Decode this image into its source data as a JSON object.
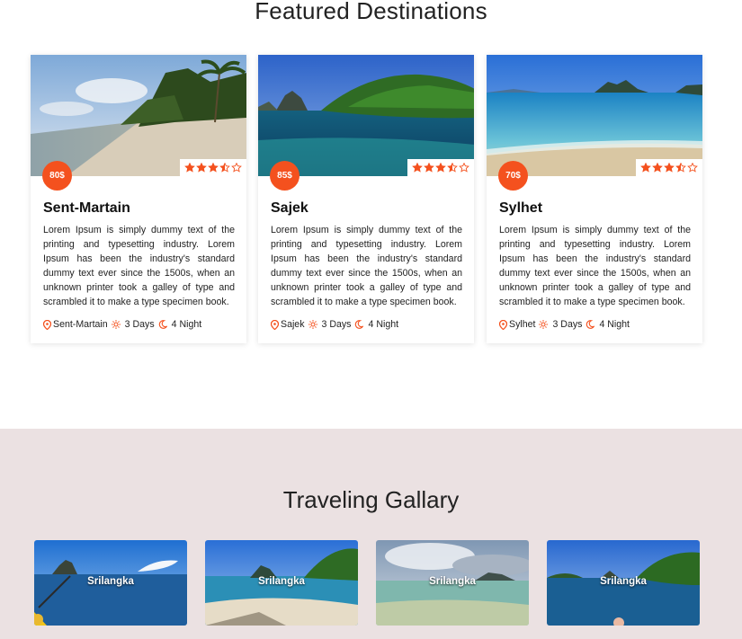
{
  "featured": {
    "title": "Featured Destinations",
    "cards": [
      {
        "price": "80$",
        "title": "Sent-Martain",
        "text": "Lorem Ipsum is simply dummy text of the printing and typesetting industry. Lorem Ipsum has been the industry's standard dummy text ever since the 1500s, when an unknown printer took a galley of type and scrambled it to make a type specimen book.",
        "location": "Sent-Martain",
        "days": "3 Days",
        "nights": "4 Night",
        "rating": 3.5
      },
      {
        "price": "85$",
        "title": "Sajek",
        "text": "Lorem Ipsum is simply dummy text of the printing and typesetting industry. Lorem Ipsum has been the industry's standard dummy text ever since the 1500s, when an unknown printer took a galley of type and scrambled it to make a type specimen book.",
        "location": "Sajek",
        "days": "3 Days",
        "nights": "4 Night",
        "rating": 3.5
      },
      {
        "price": "70$",
        "title": "Sylhet",
        "text": "Lorem Ipsum is simply dummy text of the printing and typesetting industry. Lorem Ipsum has been the industry's standard dummy text ever since the 1500s, when an unknown printer took a galley of type and scrambled it to make a type specimen book.",
        "location": "Sylhet",
        "days": "3 Days",
        "nights": "4 Night",
        "rating": 3.5
      }
    ]
  },
  "gallery": {
    "title": "Traveling Gallary",
    "items": [
      {
        "label": "Srilangka"
      },
      {
        "label": "Srilangka"
      },
      {
        "label": "Srilangka"
      },
      {
        "label": "Srilangka"
      }
    ]
  },
  "colors": {
    "accent": "#f4511e",
    "gallery_bg": "#ebe1e2"
  },
  "icons": {
    "location": "map-pin-icon",
    "days": "sun-icon",
    "nights": "moon-icon",
    "rating": "star-icon"
  }
}
